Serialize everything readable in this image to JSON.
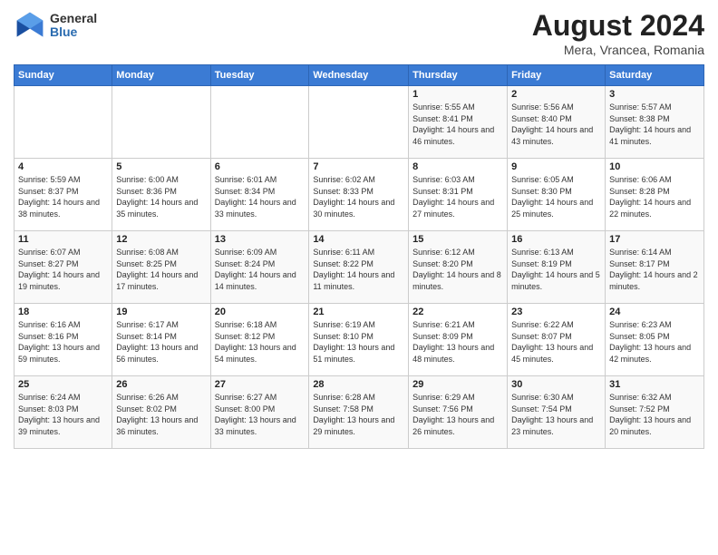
{
  "logo": {
    "general": "General",
    "blue": "Blue"
  },
  "title": {
    "month_year": "August 2024",
    "location": "Mera, Vrancea, Romania"
  },
  "days_of_week": [
    "Sunday",
    "Monday",
    "Tuesday",
    "Wednesday",
    "Thursday",
    "Friday",
    "Saturday"
  ],
  "weeks": [
    [
      {
        "day": "",
        "info": ""
      },
      {
        "day": "",
        "info": ""
      },
      {
        "day": "",
        "info": ""
      },
      {
        "day": "",
        "info": ""
      },
      {
        "day": "1",
        "info": "Sunrise: 5:55 AM\nSunset: 8:41 PM\nDaylight: 14 hours and 46 minutes."
      },
      {
        "day": "2",
        "info": "Sunrise: 5:56 AM\nSunset: 8:40 PM\nDaylight: 14 hours and 43 minutes."
      },
      {
        "day": "3",
        "info": "Sunrise: 5:57 AM\nSunset: 8:38 PM\nDaylight: 14 hours and 41 minutes."
      }
    ],
    [
      {
        "day": "4",
        "info": "Sunrise: 5:59 AM\nSunset: 8:37 PM\nDaylight: 14 hours and 38 minutes."
      },
      {
        "day": "5",
        "info": "Sunrise: 6:00 AM\nSunset: 8:36 PM\nDaylight: 14 hours and 35 minutes."
      },
      {
        "day": "6",
        "info": "Sunrise: 6:01 AM\nSunset: 8:34 PM\nDaylight: 14 hours and 33 minutes."
      },
      {
        "day": "7",
        "info": "Sunrise: 6:02 AM\nSunset: 8:33 PM\nDaylight: 14 hours and 30 minutes."
      },
      {
        "day": "8",
        "info": "Sunrise: 6:03 AM\nSunset: 8:31 PM\nDaylight: 14 hours and 27 minutes."
      },
      {
        "day": "9",
        "info": "Sunrise: 6:05 AM\nSunset: 8:30 PM\nDaylight: 14 hours and 25 minutes."
      },
      {
        "day": "10",
        "info": "Sunrise: 6:06 AM\nSunset: 8:28 PM\nDaylight: 14 hours and 22 minutes."
      }
    ],
    [
      {
        "day": "11",
        "info": "Sunrise: 6:07 AM\nSunset: 8:27 PM\nDaylight: 14 hours and 19 minutes."
      },
      {
        "day": "12",
        "info": "Sunrise: 6:08 AM\nSunset: 8:25 PM\nDaylight: 14 hours and 17 minutes."
      },
      {
        "day": "13",
        "info": "Sunrise: 6:09 AM\nSunset: 8:24 PM\nDaylight: 14 hours and 14 minutes."
      },
      {
        "day": "14",
        "info": "Sunrise: 6:11 AM\nSunset: 8:22 PM\nDaylight: 14 hours and 11 minutes."
      },
      {
        "day": "15",
        "info": "Sunrise: 6:12 AM\nSunset: 8:20 PM\nDaylight: 14 hours and 8 minutes."
      },
      {
        "day": "16",
        "info": "Sunrise: 6:13 AM\nSunset: 8:19 PM\nDaylight: 14 hours and 5 minutes."
      },
      {
        "day": "17",
        "info": "Sunrise: 6:14 AM\nSunset: 8:17 PM\nDaylight: 14 hours and 2 minutes."
      }
    ],
    [
      {
        "day": "18",
        "info": "Sunrise: 6:16 AM\nSunset: 8:16 PM\nDaylight: 13 hours and 59 minutes."
      },
      {
        "day": "19",
        "info": "Sunrise: 6:17 AM\nSunset: 8:14 PM\nDaylight: 13 hours and 56 minutes."
      },
      {
        "day": "20",
        "info": "Sunrise: 6:18 AM\nSunset: 8:12 PM\nDaylight: 13 hours and 54 minutes."
      },
      {
        "day": "21",
        "info": "Sunrise: 6:19 AM\nSunset: 8:10 PM\nDaylight: 13 hours and 51 minutes."
      },
      {
        "day": "22",
        "info": "Sunrise: 6:21 AM\nSunset: 8:09 PM\nDaylight: 13 hours and 48 minutes."
      },
      {
        "day": "23",
        "info": "Sunrise: 6:22 AM\nSunset: 8:07 PM\nDaylight: 13 hours and 45 minutes."
      },
      {
        "day": "24",
        "info": "Sunrise: 6:23 AM\nSunset: 8:05 PM\nDaylight: 13 hours and 42 minutes."
      }
    ],
    [
      {
        "day": "25",
        "info": "Sunrise: 6:24 AM\nSunset: 8:03 PM\nDaylight: 13 hours and 39 minutes."
      },
      {
        "day": "26",
        "info": "Sunrise: 6:26 AM\nSunset: 8:02 PM\nDaylight: 13 hours and 36 minutes."
      },
      {
        "day": "27",
        "info": "Sunrise: 6:27 AM\nSunset: 8:00 PM\nDaylight: 13 hours and 33 minutes."
      },
      {
        "day": "28",
        "info": "Sunrise: 6:28 AM\nSunset: 7:58 PM\nDaylight: 13 hours and 29 minutes."
      },
      {
        "day": "29",
        "info": "Sunrise: 6:29 AM\nSunset: 7:56 PM\nDaylight: 13 hours and 26 minutes."
      },
      {
        "day": "30",
        "info": "Sunrise: 6:30 AM\nSunset: 7:54 PM\nDaylight: 13 hours and 23 minutes."
      },
      {
        "day": "31",
        "info": "Sunrise: 6:32 AM\nSunset: 7:52 PM\nDaylight: 13 hours and 20 minutes."
      }
    ]
  ]
}
